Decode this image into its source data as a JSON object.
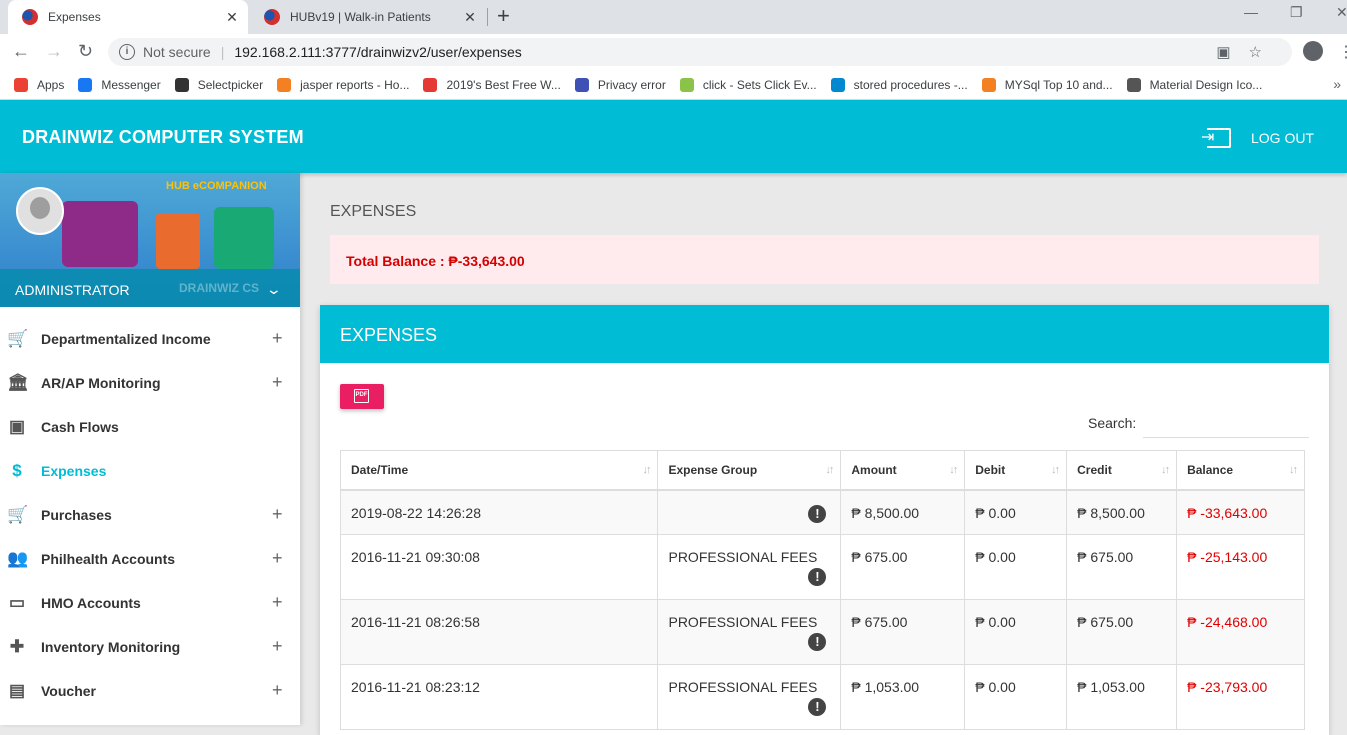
{
  "browser": {
    "tabs": [
      {
        "title": "Expenses"
      },
      {
        "title": "HUBv19 | Walk-in Patients"
      }
    ],
    "security": "Not secure",
    "url": "192.168.2.111:3777/drainwizv2/user/expenses",
    "bookmarks": [
      {
        "label": "Apps",
        "color": "#ea4335"
      },
      {
        "label": "Messenger",
        "color": "#1877f2"
      },
      {
        "label": "Selectpicker",
        "color": "#333333"
      },
      {
        "label": "jasper reports - Ho...",
        "color": "#f48024"
      },
      {
        "label": "2019's Best Free W...",
        "color": "#e53935"
      },
      {
        "label": "Privacy error",
        "color": "#3f51b5"
      },
      {
        "label": "click - Sets Click Ev...",
        "color": "#8bc34a"
      },
      {
        "label": "stored procedures -...",
        "color": "#0288d1"
      },
      {
        "label": "MYSql Top 10 and...",
        "color": "#f48024"
      },
      {
        "label": "Material Design Ico...",
        "color": "#555555"
      }
    ]
  },
  "app": {
    "brand": "DRAINWIZ COMPUTER SYSTEM",
    "logout": "LOG OUT",
    "accent": "#00bcd4"
  },
  "sidebar": {
    "banner_text": "HUB eCOMPANION",
    "role": "ADMINISTRATOR",
    "watermark": "DRAINWIZ CS",
    "items": [
      {
        "label": "Departmentalized Income",
        "icon": "cart-icon",
        "glyph": "🛒",
        "expandable": true,
        "active": false
      },
      {
        "label": "AR/AP Monitoring",
        "icon": "bank-icon",
        "glyph": "🏛",
        "expandable": true,
        "active": false
      },
      {
        "label": "Cash Flows",
        "icon": "wallet-icon",
        "glyph": "▣",
        "expandable": false,
        "active": false
      },
      {
        "label": "Expenses",
        "icon": "dollar-icon",
        "glyph": "$",
        "expandable": false,
        "active": true
      },
      {
        "label": "Purchases",
        "icon": "cart-icon",
        "glyph": "🛒",
        "expandable": true,
        "active": false
      },
      {
        "label": "Philhealth Accounts",
        "icon": "people-icon",
        "glyph": "👥",
        "expandable": true,
        "active": false
      },
      {
        "label": "HMO Accounts",
        "icon": "monitor-icon",
        "glyph": "▭",
        "expandable": true,
        "active": false
      },
      {
        "label": "Inventory Monitoring",
        "icon": "medical-kit-icon",
        "glyph": "✚",
        "expandable": true,
        "active": false
      },
      {
        "label": "Voucher",
        "icon": "ticket-icon",
        "glyph": "▤",
        "expandable": true,
        "active": false
      }
    ]
  },
  "main": {
    "page_title": "EXPENSES",
    "total_balance": "Total Balance : ₱-33,643.00",
    "card_title": "EXPENSES",
    "pdf_label": "PDF",
    "search_label": "Search:",
    "search_value": "",
    "columns": [
      "Date/Time",
      "Expense Group",
      "Amount",
      "Debit",
      "Credit",
      "Balance"
    ],
    "rows": [
      {
        "datetime": "2019-08-22 14:26:28",
        "group": "",
        "amount": "₱ 8,500.00",
        "debit": "₱ 0.00",
        "credit": "₱ 8,500.00",
        "balance": "₱ -33,643.00"
      },
      {
        "datetime": "2016-11-21 09:30:08",
        "group": "PROFESSIONAL FEES",
        "amount": "₱ 675.00",
        "debit": "₱ 0.00",
        "credit": "₱ 675.00",
        "balance": "₱ -25,143.00"
      },
      {
        "datetime": "2016-11-21 08:26:58",
        "group": "PROFESSIONAL FEES",
        "amount": "₱ 675.00",
        "debit": "₱ 0.00",
        "credit": "₱ 675.00",
        "balance": "₱ -24,468.00"
      },
      {
        "datetime": "2016-11-21 08:23:12",
        "group": "PROFESSIONAL FEES",
        "amount": "₱ 1,053.00",
        "debit": "₱ 0.00",
        "credit": "₱ 1,053.00",
        "balance": "₱ -23,793.00"
      }
    ]
  }
}
